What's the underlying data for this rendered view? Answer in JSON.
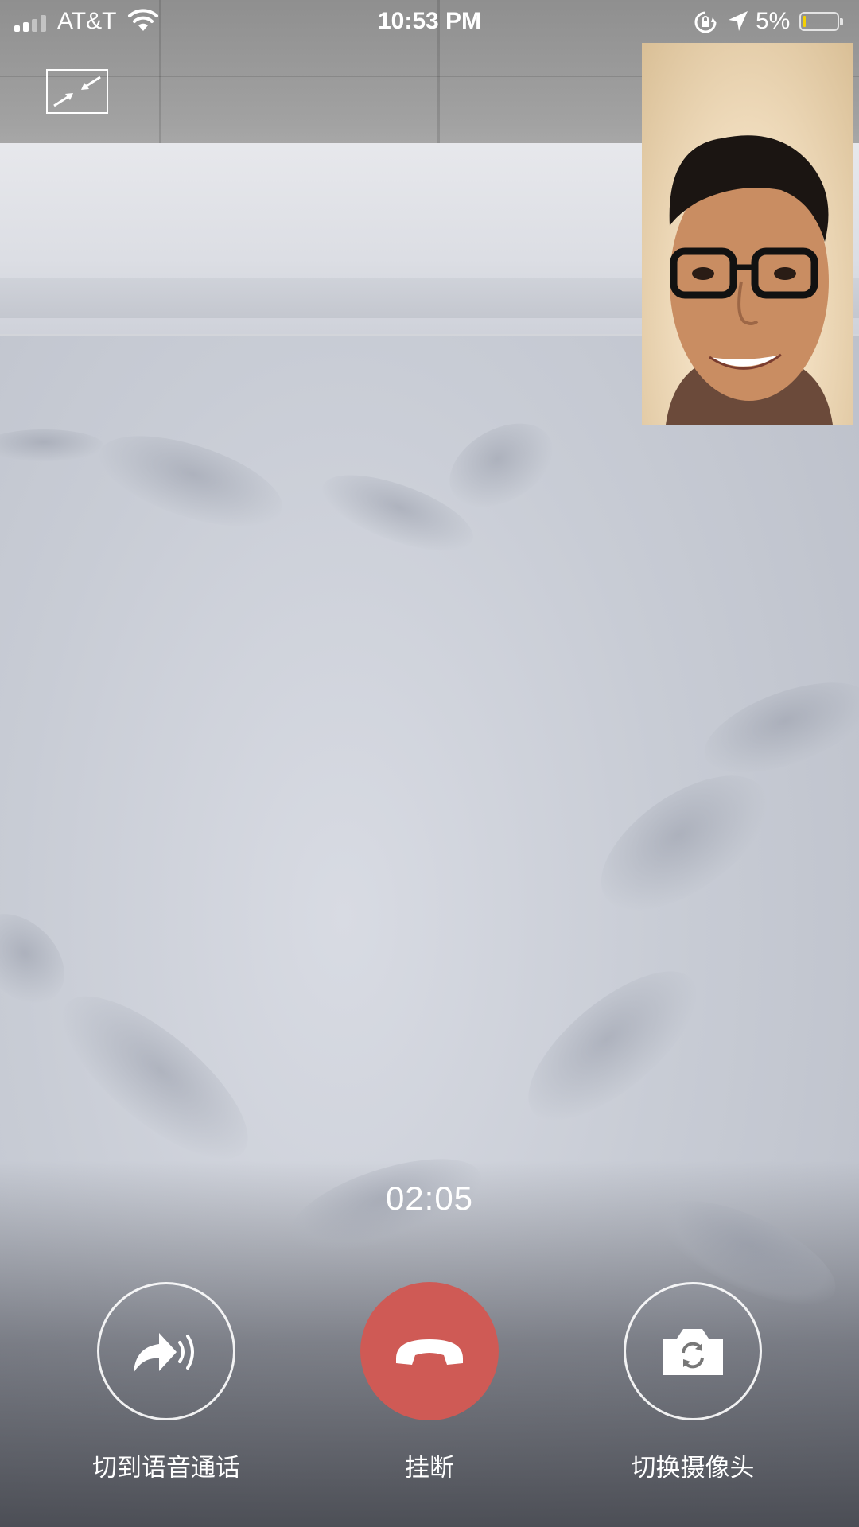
{
  "status_bar": {
    "carrier": "AT&T",
    "time": "10:53 PM",
    "battery_percent": "5%",
    "battery_level": 0.05,
    "signal_bars_active": 2,
    "signal_bars_total": 4
  },
  "call": {
    "duration": "02:05"
  },
  "controls": {
    "switch_to_voice_label": "切到语音通话",
    "hang_up_label": "挂断",
    "switch_camera_label": "切换摄像头"
  },
  "colors": {
    "hang_up": "#cf5a55",
    "battery_fill": "#f5d000"
  },
  "icons": {
    "minimize": "minimize-arrows-icon",
    "voice": "voice-forward-icon",
    "hang_up": "phone-hangup-icon",
    "camera": "camera-switch-icon"
  }
}
